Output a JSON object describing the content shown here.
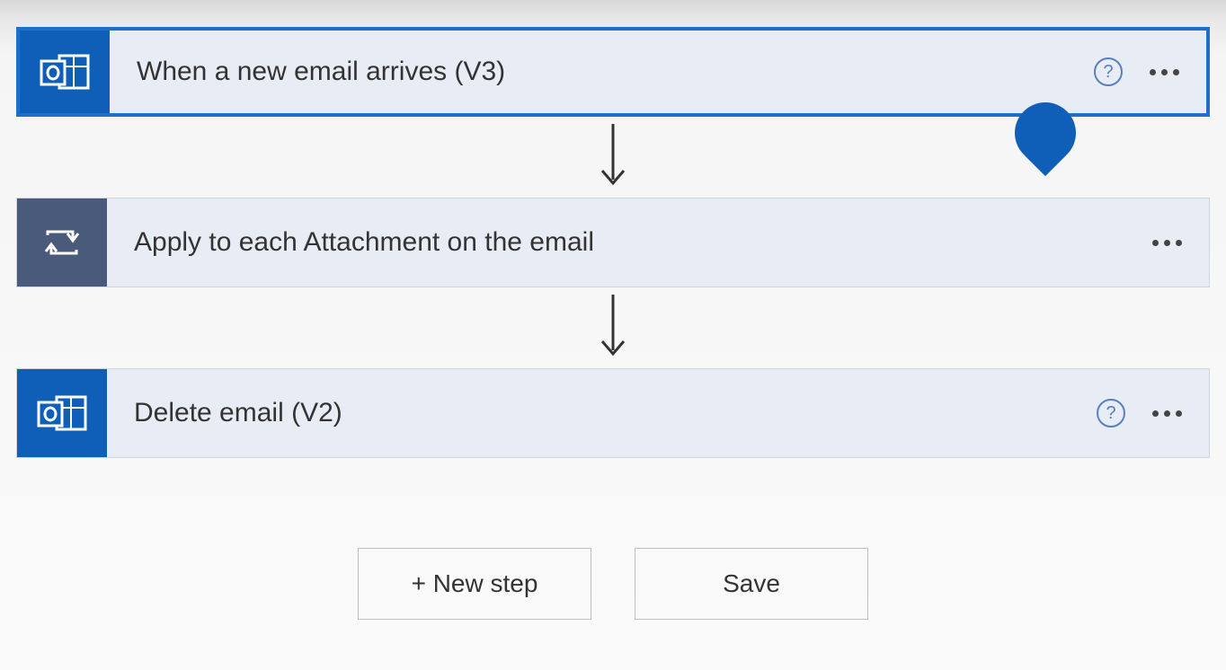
{
  "steps": [
    {
      "title": "When a new email arrives (V3)",
      "icon": "outlook",
      "selected": true,
      "hasHelp": true,
      "showInsertHandle": true
    },
    {
      "title": "Apply to each Attachment on the email",
      "icon": "loop",
      "selected": false,
      "hasHelp": false,
      "showInsertHandle": false
    },
    {
      "title": "Delete email (V2)",
      "icon": "outlook",
      "selected": false,
      "hasHelp": true,
      "showInsertHandle": false
    }
  ],
  "buttons": {
    "newStep": "+ New step",
    "save": "Save"
  }
}
